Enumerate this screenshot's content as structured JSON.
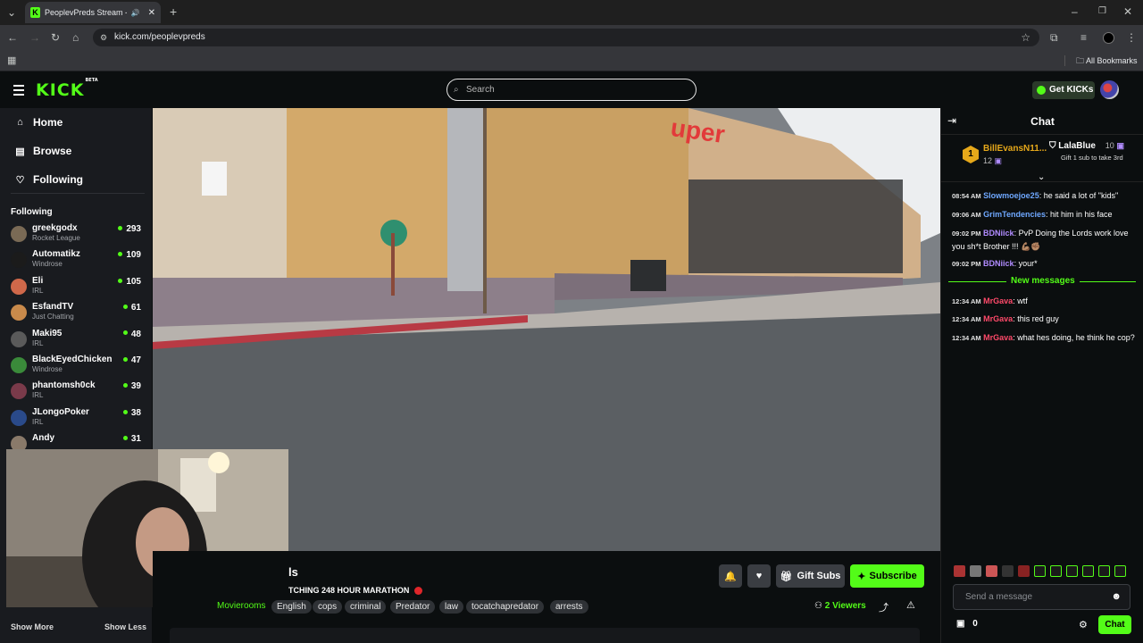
{
  "browser": {
    "tab_title": "PeoplevPreds Stream - Wa",
    "url": "kick.com/peoplevpreds",
    "bookmarks_label": "All Bookmarks"
  },
  "header": {
    "logo": "KICK",
    "logo_badge": "BETA",
    "search_placeholder": "Search",
    "get_kicks_label": "Get KICKs"
  },
  "sidebar": {
    "nav": [
      {
        "label": "Home",
        "icon": "home-icon"
      },
      {
        "label": "Browse",
        "icon": "browse-icon"
      },
      {
        "label": "Following",
        "icon": "heart-icon"
      }
    ],
    "following_title": "Following",
    "following": [
      {
        "name": "greekgodx",
        "category": "Rocket League",
        "viewers": "293",
        "color": "#7a6a55"
      },
      {
        "name": "Automatikz",
        "category": "Windrose",
        "viewers": "109",
        "color": "#1b1b1b"
      },
      {
        "name": "Eli",
        "category": "IRL",
        "viewers": "105",
        "color": "#d0684a"
      },
      {
        "name": "EsfandTV",
        "category": "Just Chatting",
        "viewers": "61",
        "color": "#c98a4b"
      },
      {
        "name": "Maki95",
        "category": "IRL",
        "viewers": "48",
        "color": "#5a5a5a"
      },
      {
        "name": "BlackEyedChicken",
        "category": "Windrose",
        "viewers": "47",
        "color": "#3a8a3a"
      },
      {
        "name": "phantomsh0ck",
        "category": "IRL",
        "viewers": "39",
        "color": "#7a3a4a"
      },
      {
        "name": "JLongoPoker",
        "category": "IRL",
        "viewers": "38",
        "color": "#2a4a8a"
      },
      {
        "name": "Andy",
        "category": "",
        "viewers": "31",
        "color": "#8a7a6a"
      }
    ],
    "show_more": "Show More",
    "show_less": "Show Less"
  },
  "stream": {
    "title_fragment": "ls",
    "subtitle": "TCHING 248 HOUR MARATHON",
    "category_fragment": "Movierooms",
    "tags": [
      "English",
      "cops",
      "criminal",
      "Predator",
      "law",
      "tocatchapredator",
      "arrests"
    ],
    "gift_subs_label": "Gift Subs",
    "subscribe_label": "Subscribe",
    "viewers_count": "2",
    "viewers_label": "Viewers"
  },
  "chat": {
    "title": "Chat",
    "leaderboard": [
      {
        "rank": "1",
        "name": "BillEvansN11...",
        "count": "12"
      },
      {
        "name": "LalaBlue",
        "count": "10",
        "note": "Gift 1 sub to take 3rd"
      }
    ],
    "messages": [
      {
        "time": "08:54 AM",
        "user": "Slowmoejoe25",
        "color": "#6fa8ff",
        "text": ": he said a lot of \"kids\""
      },
      {
        "time": "09:06 AM",
        "user": "GrimTendencies",
        "color": "#6fa8ff",
        "text": ": hit him in his face"
      },
      {
        "time": "09:02 PM",
        "user": "BDNiick",
        "color": "#b18cff",
        "text": ": PvP Doing the Lords work love you sh*t Brother !!! 💪🏽✊🏽"
      },
      {
        "time": "09:02 PM",
        "user": "BDNiick",
        "color": "#b18cff",
        "text": ": your*"
      }
    ],
    "new_messages_label": "New messages",
    "new_messages": [
      {
        "time": "12:34 AM",
        "user": "MrGava",
        "color": "#ff4a6a",
        "text": ": wtf"
      },
      {
        "time": "12:34 AM",
        "user": "MrGava",
        "color": "#ff4a6a",
        "text": ": this red guy"
      },
      {
        "time": "12:34 AM",
        "user": "MrGava",
        "color": "#ff4a6a",
        "text": ": what hes doing, he think he cop?"
      }
    ],
    "input_placeholder": "Send a message",
    "points": "0",
    "send_label": "Chat"
  },
  "colors": {
    "accent": "#53fc18",
    "bg": "#0b0e0f",
    "sidebar": "#191b1f"
  }
}
